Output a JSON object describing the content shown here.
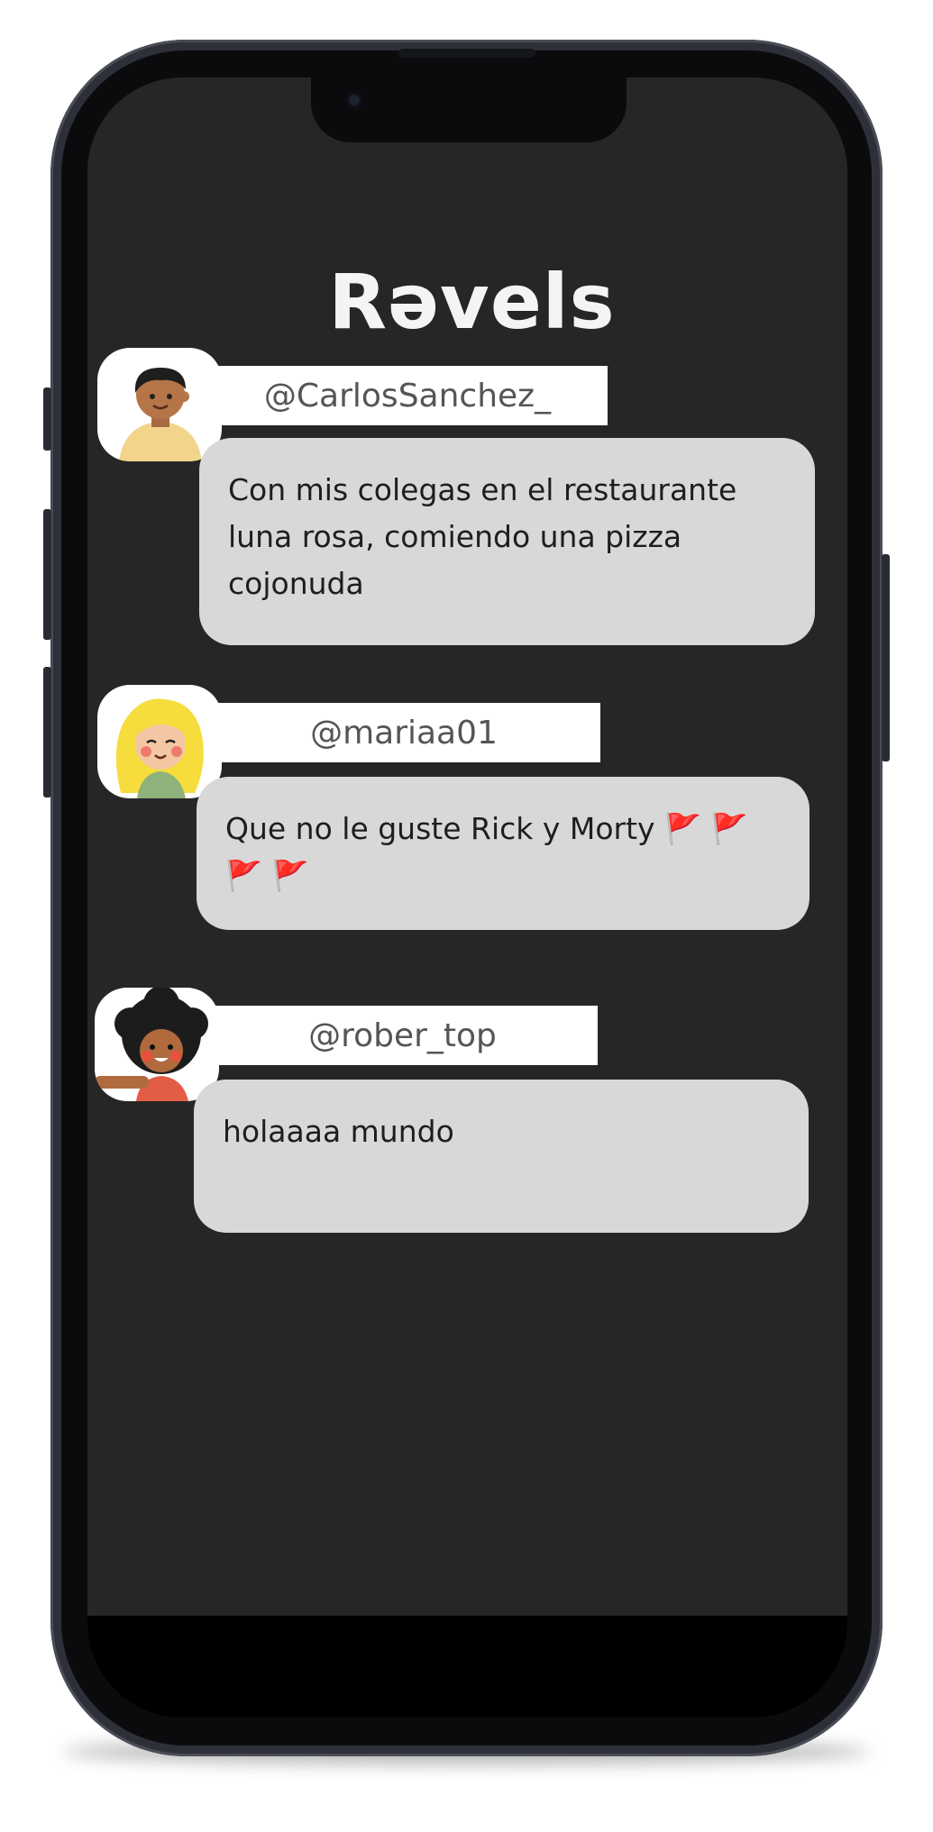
{
  "app": {
    "title": "Rəvels"
  },
  "posts": [
    {
      "handle": "@CarlosSanchez_",
      "text": "Con mis colegas en el restaurante luna rosa, comiendo una pizza cojonuda",
      "avatar": "boy-avatar-icon"
    },
    {
      "handle": "@mariaa01",
      "text": "Que no le guste Rick y Morty",
      "flags": "🚩 🚩 🚩 🚩",
      "avatar": "blonde-girl-avatar-icon"
    },
    {
      "handle": "@rober_top",
      "text": "holaaaa mundo",
      "avatar": "curly-hair-avatar-icon"
    }
  ],
  "colors": {
    "screen_bg": "#262626",
    "bubble_bg": "#d8d8d8",
    "handle_bg": "#ffffff",
    "flag": "#e53935"
  }
}
